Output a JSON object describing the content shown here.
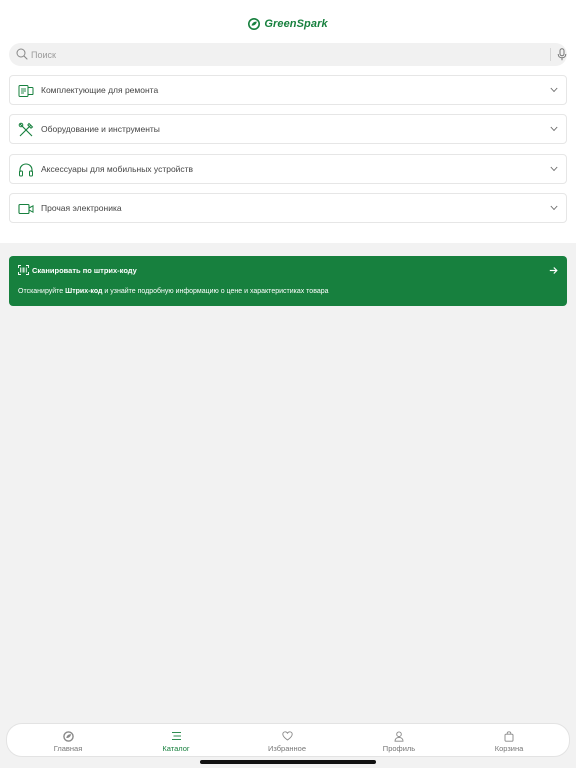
{
  "brand": {
    "name": "GreenSpark",
    "color": "#17803e"
  },
  "search": {
    "placeholder": "Поиск",
    "value": ""
  },
  "categories": [
    {
      "label": "Комплектующие для ремонта",
      "icon": "phone-parts-icon"
    },
    {
      "label": "Оборудование и инструменты",
      "icon": "tools-icon"
    },
    {
      "label": "Аксессуары для мобильных устройств",
      "icon": "headphones-icon"
    },
    {
      "label": "Прочая электроника",
      "icon": "video-camera-icon"
    }
  ],
  "scan_banner": {
    "title": "Сканировать по штрих-коду",
    "desc_prefix": "Отсканируйте ",
    "desc_bold": "Штрих-код",
    "desc_suffix": " и узнайте подробную информацию о цене и характеристиках товара",
    "background": "#17803e"
  },
  "tabs": [
    {
      "label": "Главная",
      "icon": "home-logo-icon",
      "active": false
    },
    {
      "label": "Каталог",
      "icon": "catalog-list-icon",
      "active": true
    },
    {
      "label": "Избранное",
      "icon": "heart-icon",
      "active": false
    },
    {
      "label": "Профиль",
      "icon": "profile-icon",
      "active": false
    },
    {
      "label": "Корзина",
      "icon": "cart-bag-icon",
      "active": false
    }
  ]
}
